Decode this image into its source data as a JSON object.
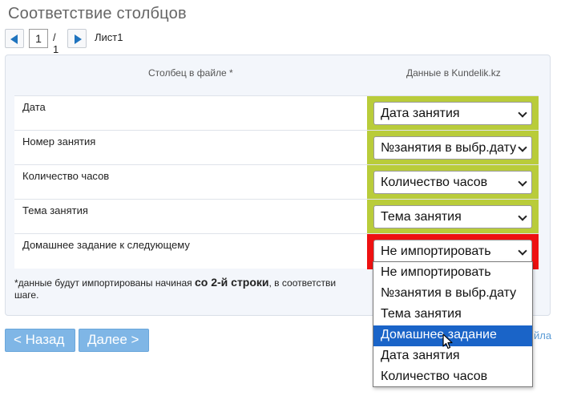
{
  "page": {
    "title": "Соответствие столбцов"
  },
  "pager": {
    "current": "1",
    "total": "/ 1",
    "sheet": "Лист1"
  },
  "table": {
    "col_file": "Столбец в файле *",
    "col_data": "Данные в Kundelik.kz",
    "rows": [
      {
        "label": "Дата",
        "value": "Дата занятия",
        "status": "ok"
      },
      {
        "label": "Номер занятия",
        "value": "№занятия в выбр.дату",
        "status": "ok"
      },
      {
        "label": "Количество часов",
        "value": "Количество часов",
        "status": "ok"
      },
      {
        "label": "Тема занятия",
        "value": "Тема занятия",
        "status": "ok"
      },
      {
        "label": "Домашнее задание к следующему",
        "value": "Не импортировать",
        "status": "error"
      }
    ]
  },
  "note": {
    "prefix": "*данные будут импортированы начиная ",
    "bold": "со 2-й строки",
    "suffix": ", в соответстви",
    "line2": "шаге."
  },
  "buttons": {
    "back": "< Назад",
    "next": "Далее >",
    "link_tail": "йла"
  },
  "dropdown": {
    "options": [
      "Не импортировать",
      "№занятия в выбр.дату",
      "Тема занятия",
      "Домашнее задание",
      "Дата занятия",
      "Количество часов"
    ],
    "highlighted": "Домашнее задание"
  },
  "colors": {
    "ok": "#b9cc3a",
    "error": "#ee1111",
    "highlight": "#1a64c8",
    "button": "#7fb6e6"
  }
}
